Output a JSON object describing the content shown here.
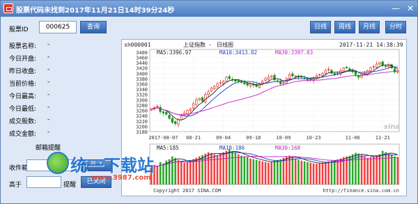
{
  "window": {
    "title": "股票代码未找到2017年11月21日14时39分24秒",
    "min_label": "—",
    "close_label": "✕"
  },
  "query": {
    "id_label": "股票ID",
    "id_value": "000625",
    "query_button": "查询"
  },
  "period_buttons": [
    "日线",
    "周线",
    "月线",
    "分时"
  ],
  "info_rows": [
    {
      "label": "股票名称:",
      "value": "-"
    },
    {
      "label": "今日开盘:",
      "value": "-"
    },
    {
      "label": "昨日收盘:",
      "value": "-"
    },
    {
      "label": "当前价格:",
      "value": "-"
    },
    {
      "label": "今日最高:",
      "value": "-"
    },
    {
      "label": "今日最低:",
      "value": "-"
    },
    {
      "label": "成交股数:",
      "value": "-"
    },
    {
      "label": "成交金额:",
      "value": "-"
    }
  ],
  "alert": {
    "title": "邮箱提醒",
    "mailbox_label": "收件箱",
    "open_button": "开 3",
    "above_label": "高于",
    "remind_label": "提醒",
    "close_button": "已关闭"
  },
  "watermark": {
    "text": "统一下载站",
    "url": "www.3987.com"
  },
  "chart_data": {
    "type": "candlestick",
    "header": {
      "code": "sh000001",
      "name": "上证指数",
      "sep": "-",
      "period": "日线图",
      "datetime": "2017-11-21 14:38:39"
    },
    "ma_labels": {
      "ma5": "MA5:3396.97",
      "ma10": "MA10:3413.82",
      "ma30": "MA30:3397.03"
    },
    "vol_ma_labels": {
      "ma5": "MA5:185",
      "ma10": "MA10:186",
      "ma30": "MA30:168"
    },
    "y_ticks": [
      3480,
      3460,
      3440,
      3420,
      3400,
      3380,
      3360,
      3340,
      3320,
      3300,
      3280,
      3260,
      3240,
      3220,
      3200,
      3180
    ],
    "ylim": [
      3180,
      3490
    ],
    "x_ticks": [
      "2017-08-07",
      "08-21",
      "09-04",
      "09-18",
      "10-09",
      "10-23",
      "11-06",
      "11-21"
    ],
    "copyright": "Copyright 2017 SINA.COM",
    "source_url": "http://finance.sina.com.cn",
    "logo": "sina",
    "close": [
      3265,
      3270,
      3275,
      3255,
      3250,
      3245,
      3230,
      3215,
      3210,
      3225,
      3240,
      3250,
      3260,
      3265,
      3285,
      3300,
      3305,
      3295,
      3320,
      3330,
      3345,
      3350,
      3360,
      3365,
      3370,
      3385,
      3380,
      3375,
      3370,
      3370,
      3365,
      3360,
      3355,
      3360,
      3355,
      3350,
      3360,
      3370,
      3380,
      3385,
      3390,
      3375,
      3370,
      3360,
      3365,
      3380,
      3395,
      3390,
      3390,
      3385,
      3385,
      3380,
      3375,
      3375,
      3380,
      3390,
      3395,
      3400,
      3410,
      3415,
      3400,
      3395,
      3400,
      3410,
      3420,
      3420,
      3410,
      3405,
      3395,
      3385,
      3395,
      3400,
      3410,
      3420,
      3425,
      3435,
      3440,
      3430,
      3425,
      3430,
      3420,
      3405,
      3410
    ],
    "volume": [
      120,
      140,
      130,
      160,
      150,
      170,
      180,
      200,
      190,
      175,
      165,
      155,
      160,
      170,
      180,
      190,
      200,
      210,
      220,
      230,
      225,
      215,
      210,
      220,
      230,
      240,
      250,
      235,
      225,
      215,
      205,
      200,
      195,
      185,
      180,
      175,
      170,
      165,
      160,
      155,
      160,
      170,
      175,
      180,
      190,
      200,
      205,
      195,
      185,
      175,
      170,
      165,
      160,
      155,
      150,
      148,
      150,
      155,
      160,
      165,
      170,
      175,
      180,
      185,
      195,
      200,
      205,
      215,
      225,
      220,
      210,
      200,
      190,
      195,
      200,
      205,
      215,
      240,
      230,
      220,
      210,
      200,
      195
    ]
  }
}
